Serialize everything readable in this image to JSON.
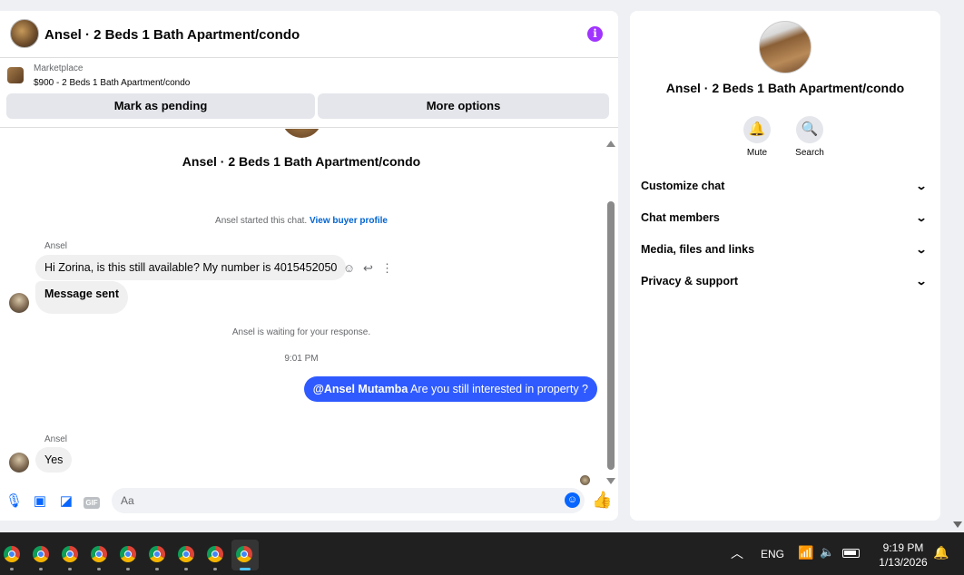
{
  "chat": {
    "header": {
      "title": "Ansel · 2 Beds 1 Bath Apartment/condo",
      "info_icon": "i"
    },
    "listing": {
      "source": "Marketplace",
      "price_title": "$900 - 2 Beds 1 Bath Apartment/condo",
      "pending_label": "Mark as pending",
      "more_label": "More options"
    },
    "thread": {
      "title": "Ansel · 2 Beds 1 Bath Apartment/condo",
      "started_text": "Ansel started this chat.",
      "buyer_profile_link": "View buyer profile",
      "sender1": "Ansel",
      "msg1": "Hi Zorina, is this still available?  My number is 4015452050",
      "msg2": "Message sent",
      "waiting_text": "Ansel is waiting for your response.",
      "timestamp": "9:01 PM",
      "out_mention": "@Ansel Mutamba",
      "out_text": " Are you still interested in property ?",
      "sender2": "Ansel",
      "msg3": "Yes"
    },
    "composer": {
      "placeholder": "Aa",
      "gif_label": "GIF"
    }
  },
  "details": {
    "title": "Ansel · 2 Beds 1 Bath Apartment/condo",
    "mute_label": "Mute",
    "search_label": "Search",
    "rows": [
      "Customize chat",
      "Chat members",
      "Media, files and links",
      "Privacy & support"
    ]
  },
  "taskbar": {
    "apps": [
      "chrome-icon",
      "chrome-icon",
      "chrome-icon",
      "chrome-icon",
      "chrome-icon",
      "chrome-icon",
      "chrome-icon",
      "chrome-icon",
      "chrome-icon"
    ],
    "active_index": 8,
    "lang": "ENG",
    "time": "9:19 PM",
    "date": "1/13/2026"
  },
  "colors": {
    "accent": "#0866ff",
    "outgoing_bubble": "#2f5aff",
    "info_purple": "#a033ff"
  }
}
